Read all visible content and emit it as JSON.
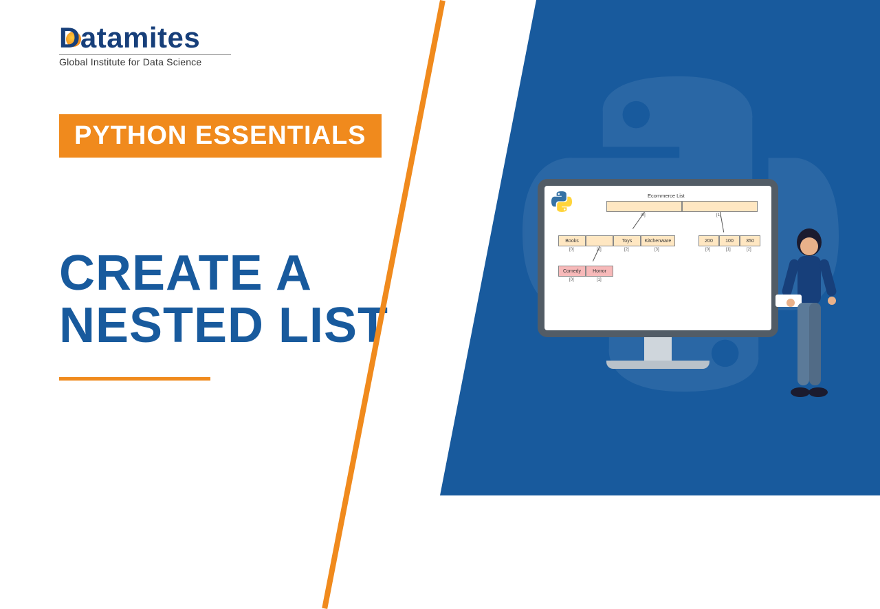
{
  "logo": {
    "brand": "Datamites",
    "tagline": "Global Institute for Data Science"
  },
  "badge": "PYTHON ESSENTIALS",
  "title_line1": "CREATE A",
  "title_line2": "NESTED LIST",
  "screen": {
    "heading": "Ecommerce List",
    "root_idx": [
      "[0]",
      "[1]"
    ],
    "cats": [
      "Books",
      "Toys",
      "Kitchenware"
    ],
    "cats_idx": [
      "[0]",
      "[1]",
      "[2]",
      "[3]"
    ],
    "nums": [
      "200",
      "100",
      "350"
    ],
    "nums_idx": [
      "[0]",
      "[1]",
      "[2]"
    ],
    "genres": [
      "Comedy",
      "Horror"
    ],
    "genres_idx": [
      "[0]",
      "[1]"
    ]
  }
}
